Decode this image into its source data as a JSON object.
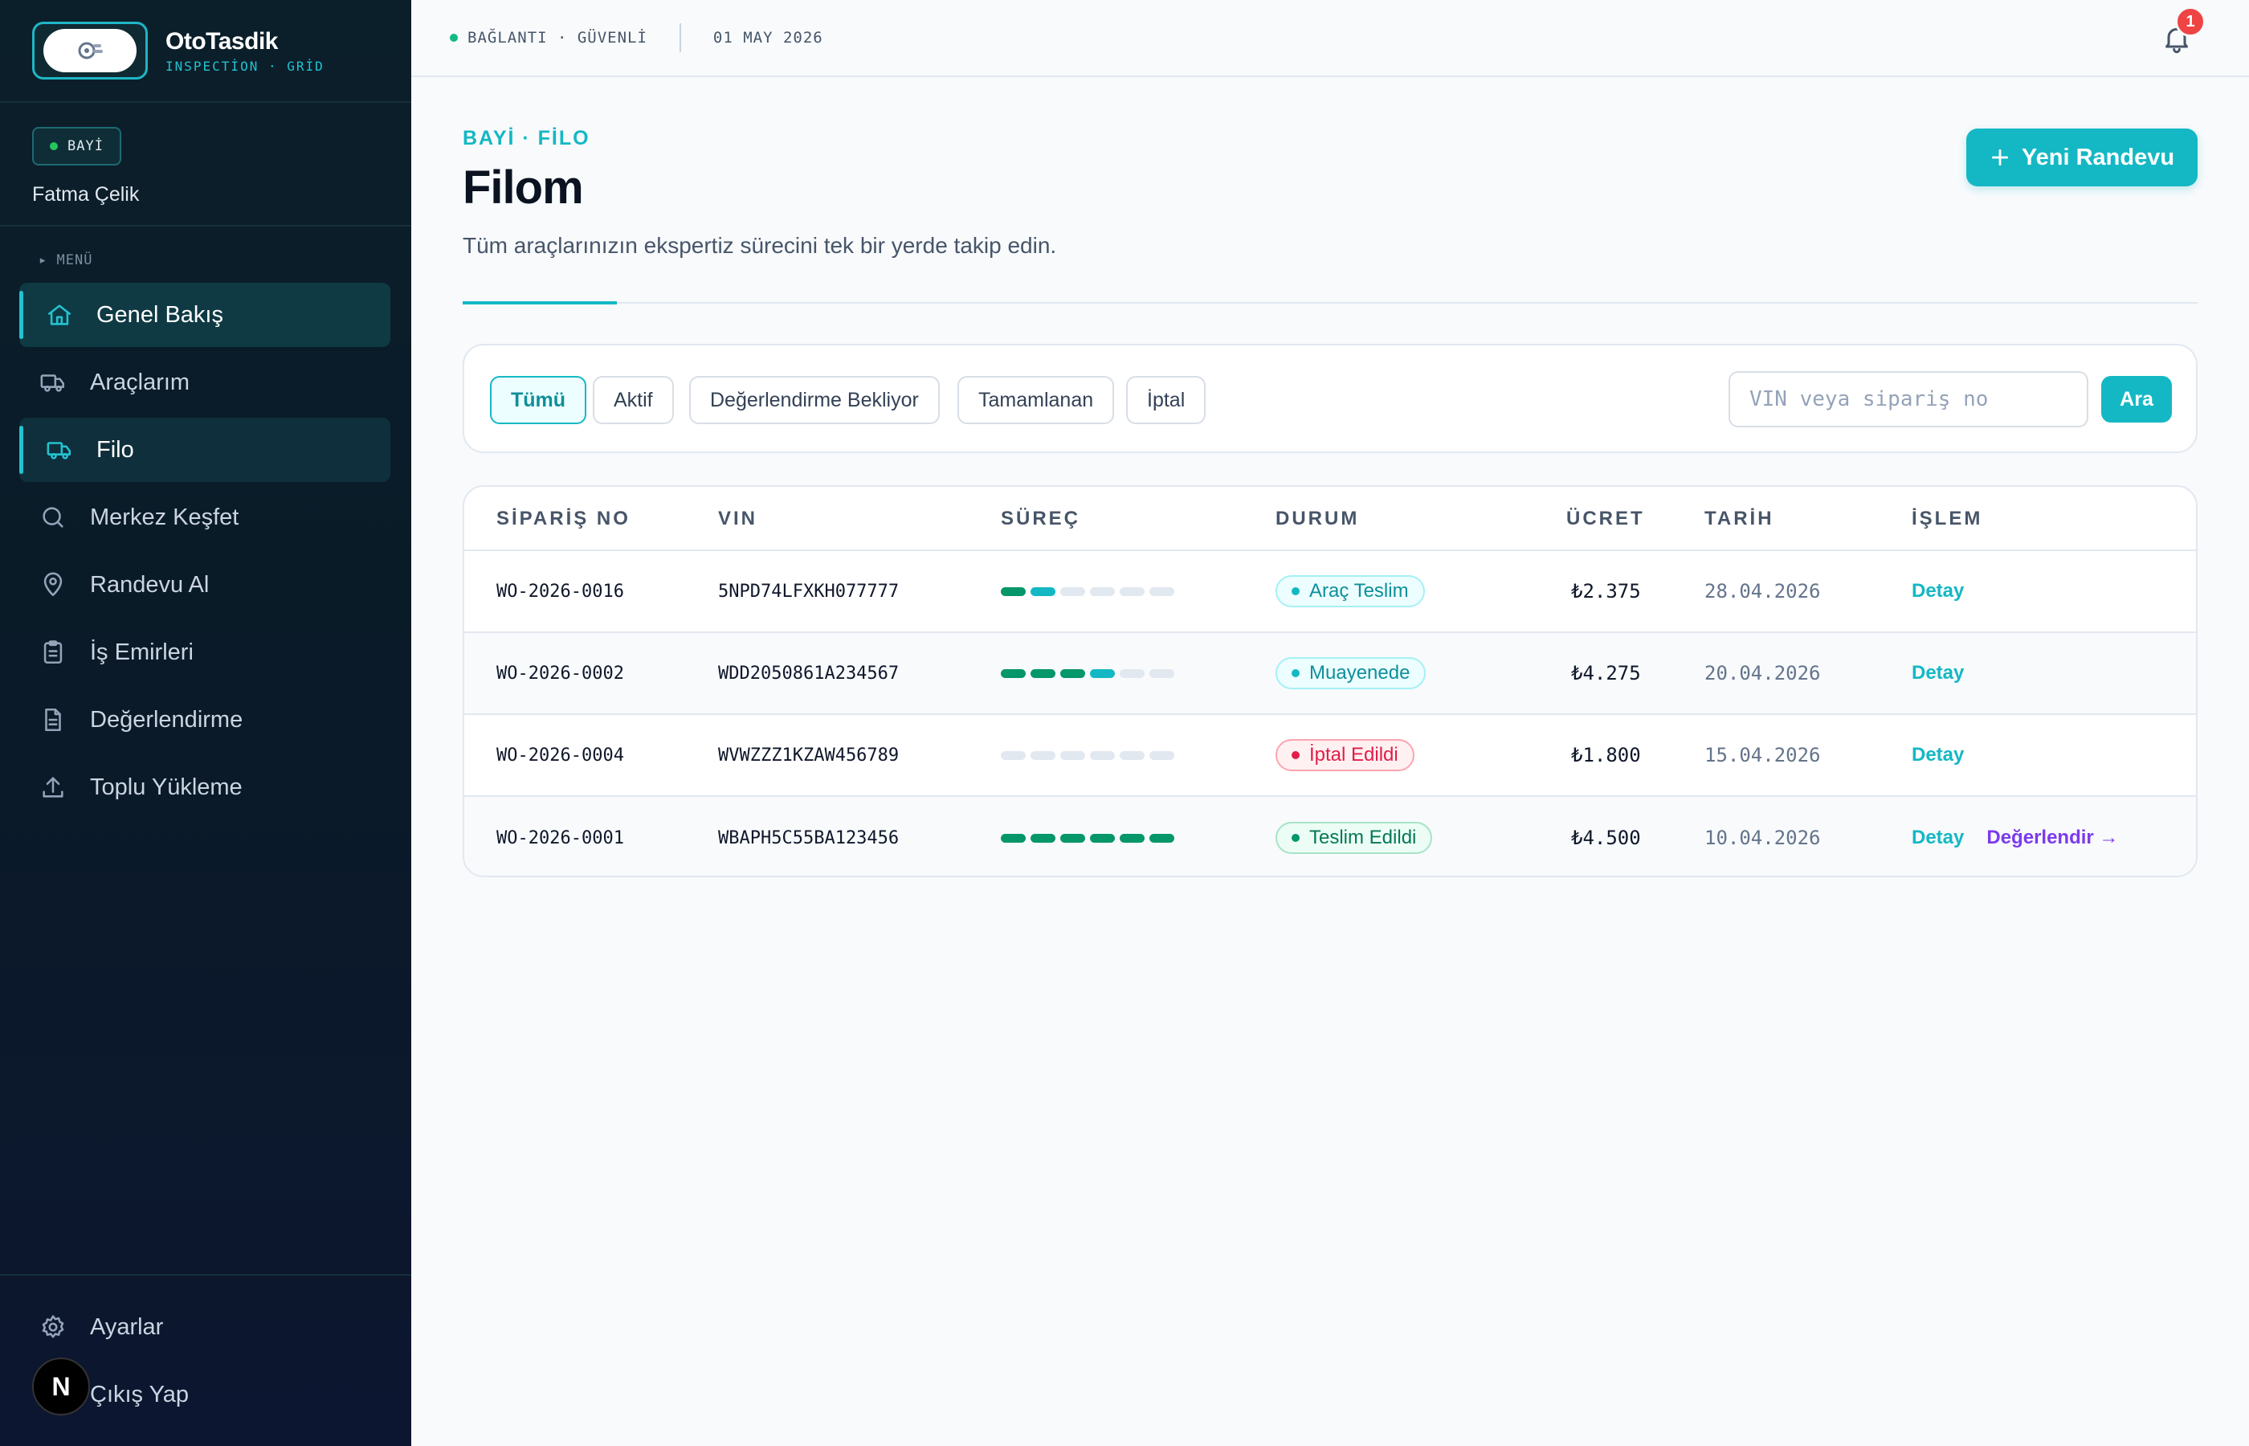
{
  "brand": {
    "name": "OtoTasdik",
    "sub": "INSPECTİON · GRİD"
  },
  "user": {
    "role": "BAYİ",
    "name": "Fatma Çelik"
  },
  "menu_label": "MENÜ",
  "nav": {
    "overview": "Genel Bakış",
    "vehicles": "Araçlarım",
    "fleet": "Filo",
    "centers": "Merkez Keşfet",
    "appointment": "Randevu Al",
    "work_orders": "İş Emirleri",
    "evaluation": "Değerlendirme",
    "bulk_upload": "Toplu Yükleme",
    "settings": "Ayarlar",
    "logout": "Çıkış Yap"
  },
  "framework_badge": "N",
  "topbar": {
    "connection": "BAĞLANTI · GÜVENLİ",
    "date": "01 MAY 2026",
    "notifications": "1"
  },
  "header": {
    "eyebrow": "BAYİ · FİLO",
    "title": "Filom",
    "subtitle": "Tüm araçlarınızın ekspertiz sürecini tek bir yerde takip edin.",
    "new_button": "Yeni Randevu"
  },
  "filters": {
    "all": "Tümü",
    "active": "Aktif",
    "pending": "Değerlendirme Bekliyor",
    "completed": "Tamamlanan",
    "cancelled": "İptal",
    "selected": "Tümü"
  },
  "search": {
    "placeholder": "VIN veya sipariş no",
    "button": "Ara"
  },
  "table": {
    "headers": {
      "order": "SİPARİŞ NO",
      "vin": "VIN",
      "process": "SÜREÇ",
      "status": "DURUM",
      "fee": "ÜCRET",
      "date": "TARİH",
      "action": "İŞLEM"
    },
    "rows": [
      {
        "order": "WO-2026-0016",
        "vin": "5NPD74LFXKH077777",
        "progress_done": 1,
        "progress_current": 1,
        "progress_total": 6,
        "status": "Araç Teslim",
        "status_type": "info",
        "fee": "₺2.375",
        "date": "28.04.2026",
        "action": "Detay",
        "extra": ""
      },
      {
        "order": "WO-2026-0002",
        "vin": "WDD2050861A234567",
        "progress_done": 3,
        "progress_current": 1,
        "progress_total": 6,
        "status": "Muayenede",
        "status_type": "info",
        "fee": "₺4.275",
        "date": "20.04.2026",
        "action": "Detay",
        "extra": ""
      },
      {
        "order": "WO-2026-0004",
        "vin": "WVWZZZ1KZAW456789",
        "progress_done": 0,
        "progress_current": 0,
        "progress_total": 6,
        "status": "İptal Edildi",
        "status_type": "danger",
        "fee": "₺1.800",
        "date": "15.04.2026",
        "action": "Detay",
        "extra": ""
      },
      {
        "order": "WO-2026-0001",
        "vin": "WBAPH5C55BA123456",
        "progress_done": 6,
        "progress_current": 0,
        "progress_total": 6,
        "status": "Teslim Edildi",
        "status_type": "success",
        "fee": "₺4.500",
        "date": "10.04.2026",
        "action": "Detay",
        "extra": "Değerlendir →"
      }
    ]
  },
  "colors": {
    "accent": "#14b8c4",
    "done": "#059669",
    "current": "#14b8c4",
    "pending": "#e2e8f0",
    "danger": "#e11d48",
    "purple": "#7c3aed"
  }
}
